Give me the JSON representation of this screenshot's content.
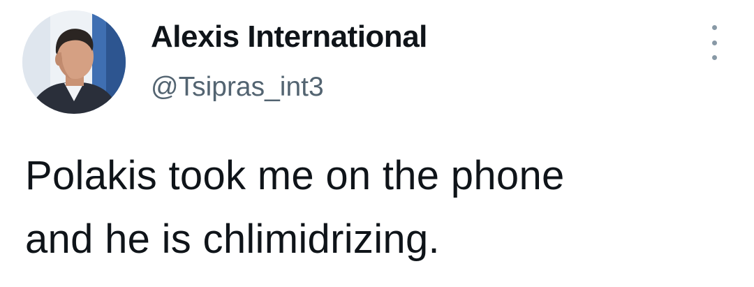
{
  "tweet": {
    "display_name": "Alexis International",
    "handle": "@Tsipras_int3",
    "text_lines": [
      "Polakis took me on the phone",
      "and he is chlimidrizing."
    ],
    "more_icon": "more-options-icon",
    "avatar_icon": "profile-avatar"
  },
  "colors": {
    "text": "#0f1419",
    "handle": "#536471",
    "more_dots": "#8899a6"
  }
}
